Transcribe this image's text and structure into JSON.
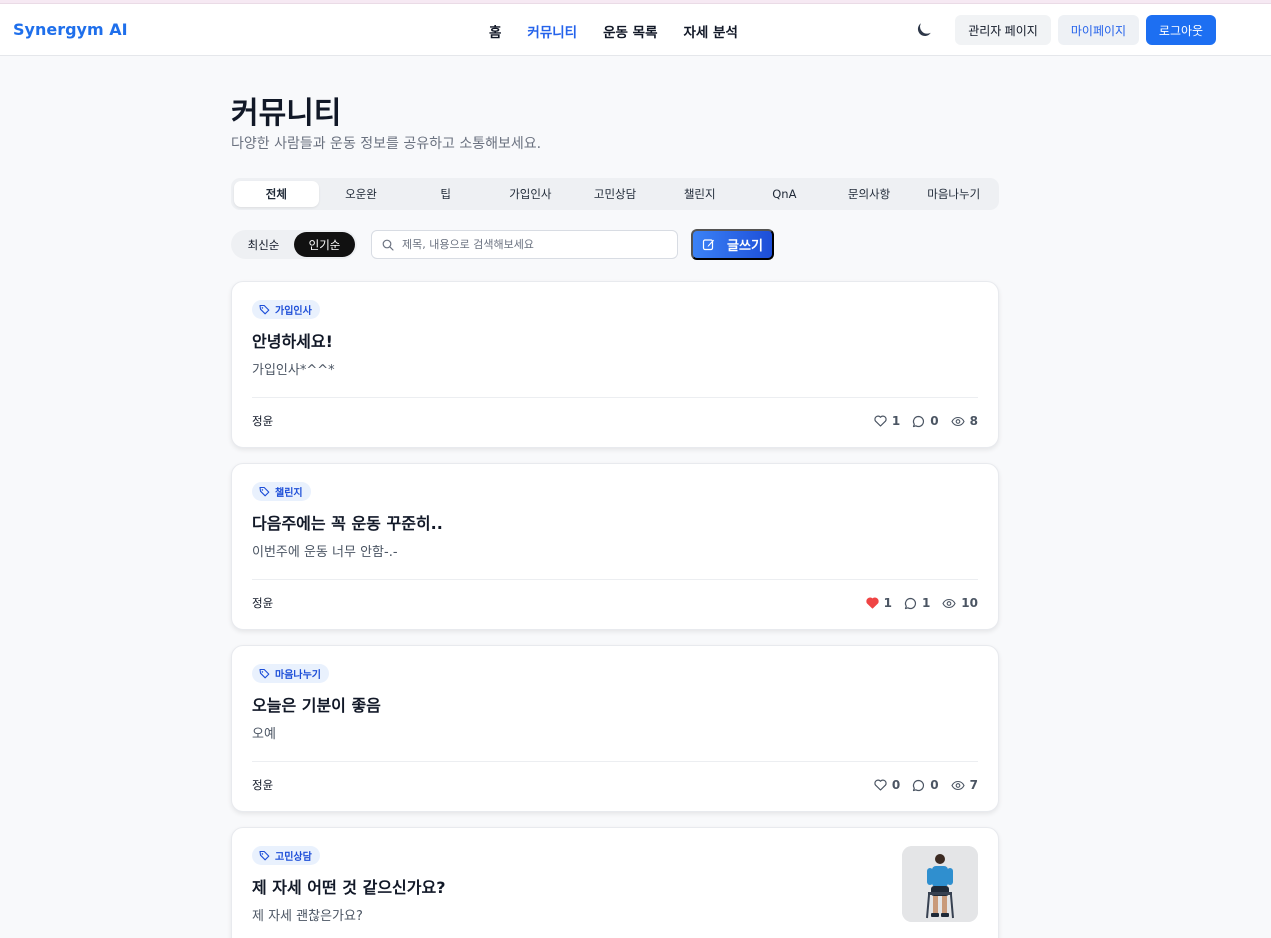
{
  "header": {
    "logo": "Synergym AI",
    "nav": [
      "홈",
      "커뮤니티",
      "운동 목록",
      "자세 분석"
    ],
    "admin_label": "관리자 페이지",
    "mypage_label": "마이페이지",
    "logout_label": "로그아웃"
  },
  "page": {
    "title": "커뮤니티",
    "subtitle": "다양한 사람들과 운동 정보를 공유하고 소통해보세요."
  },
  "tabs": [
    "전체",
    "오운완",
    "팁",
    "가입인사",
    "고민상담",
    "챌린지",
    "QnA",
    "문의사항",
    "마음나누기"
  ],
  "sort": {
    "latest": "최신순",
    "popular": "인기순",
    "active": "popular"
  },
  "search": {
    "placeholder": "제목, 내용으로 검색해보세요"
  },
  "write_label": "글쓰기",
  "posts": [
    {
      "tag": "가입인사",
      "title": "안녕하세요!",
      "body": "가입인사*^^*",
      "author": "정윤",
      "likes": "1",
      "comments": "0",
      "views": "8",
      "liked": false
    },
    {
      "tag": "챌린지",
      "title": "다음주에는 꼭 운동 꾸준히..",
      "body": "이번주에 운동 너무 안함-.-",
      "author": "정윤",
      "likes": "1",
      "comments": "1",
      "views": "10",
      "liked": true
    },
    {
      "tag": "마음나누기",
      "title": "오늘은 기분이 좋음",
      "body": "오예",
      "author": "정윤",
      "likes": "0",
      "comments": "0",
      "views": "7",
      "liked": false
    },
    {
      "tag": "고민상담",
      "title": "제 자세 어떤 것 같으신가요?",
      "body": "제 자세 괜찮은가요?",
      "author": "",
      "likes": "",
      "comments": "",
      "views": "",
      "liked": false
    }
  ],
  "colors": {
    "accent": "#2563eb",
    "like": "#ef4444"
  }
}
